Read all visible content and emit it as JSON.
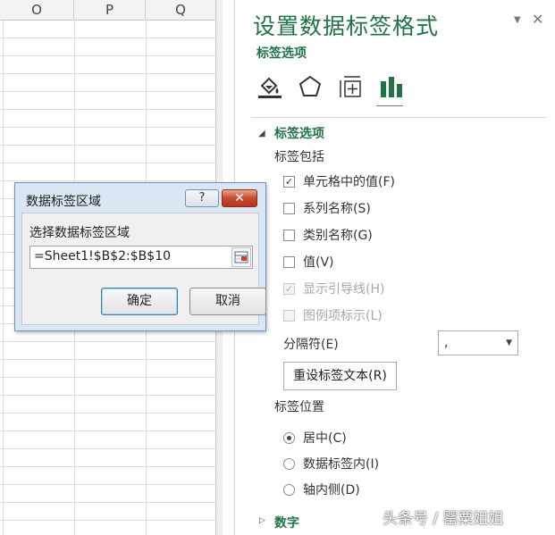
{
  "sheet": {
    "columns": [
      "O",
      "P",
      "Q"
    ]
  },
  "pane": {
    "title": "设置数据标签格式",
    "subtitle": "标签选项",
    "icons": [
      "fill-line-icon",
      "effects-icon",
      "size-properties-icon",
      "label-options-icon"
    ],
    "section_label_options": {
      "title": "标签选项",
      "include_title": "标签包括",
      "checkboxes": [
        {
          "label": "单元格中的值(F)",
          "checked": true,
          "disabled": false
        },
        {
          "label": "系列名称(S)",
          "checked": false,
          "disabled": false
        },
        {
          "label": "类别名称(G)",
          "checked": false,
          "disabled": false
        },
        {
          "label": "值(V)",
          "checked": false,
          "disabled": false
        },
        {
          "label": "显示引导线(H)",
          "checked": true,
          "disabled": true
        },
        {
          "label": "图例项标示(L)",
          "checked": false,
          "disabled": true
        }
      ],
      "separator_label": "分隔符(E)",
      "separator_value": ",",
      "reset_button": "重设标签文本(R)",
      "position_title": "标签位置",
      "positions": [
        {
          "label": "居中(C)",
          "selected": true
        },
        {
          "label": "数据标签内(I)",
          "selected": false
        },
        {
          "label": "轴内侧(D)",
          "selected": false
        }
      ]
    },
    "section_number": {
      "title": "数字"
    },
    "ctl_dropdown": "▼",
    "ctl_close": "✕"
  },
  "dialog": {
    "title": "数据标签区域",
    "help": "?",
    "close": "✕",
    "prompt": "选择数据标签区域",
    "range_value": "=Sheet1!$B$2:$B$10",
    "ok": "确定",
    "cancel": "取消"
  },
  "watermark": "头条号 / 罂粟姐姐",
  "colors": {
    "accent_green": "#217346"
  }
}
